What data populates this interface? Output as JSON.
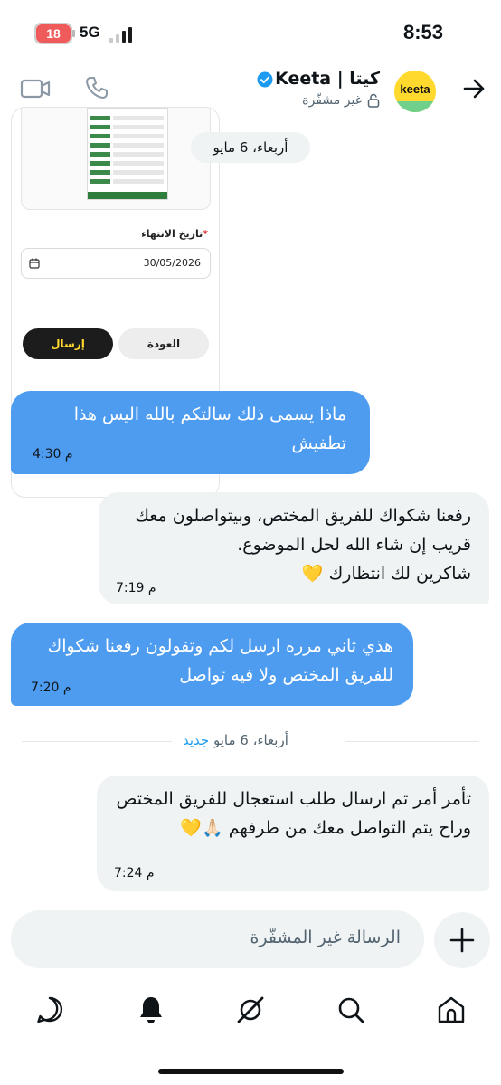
{
  "status_bar": {
    "battery": "18",
    "network": "5G",
    "time": "8:53"
  },
  "header": {
    "name": "Keeta | كيتا",
    "subtitle": "غير مشفّرة",
    "avatar_text": "keeta",
    "colors": {
      "avatar_bg": "#ffd92e",
      "verified": "#1d9bf0"
    }
  },
  "form_card": {
    "end_date_label": "تاريخ الانتهاء",
    "required_mark": "*",
    "end_date_value": "30/05/2026",
    "send_label": "إرسال",
    "back_label": "العودة"
  },
  "date_pill": "أربعاء، 6 مايو",
  "messages": [
    {
      "direction": "out",
      "text": "ماذا يسمى ذلك سالتكم بالله اليس هذا تطفيش",
      "time": "4:30 م"
    },
    {
      "direction": "in",
      "text": "رفعنا شكواك للفريق المختص، وبيتواصلون معك قريب إن شاء الله لحل الموضوع.\nشاكرين لك انتظارك 💛",
      "time": "7:19 م"
    },
    {
      "direction": "out",
      "text": "هذي ثاني مرره ارسل لكم وتقولون رفعنا شكواك للفريق المختص ولا فيه تواصل",
      "time": "7:20 م"
    },
    {
      "direction": "in",
      "text": "تأمر أمر تم ارسال طلب استعجال للفريق المختص وراح يتم التواصل معك من طرفهم 🙏🏻💛",
      "time": "7:24 م"
    }
  ],
  "divider": {
    "date": "أربعاء، 6 مايو",
    "new_label": "جديد"
  },
  "composer": {
    "placeholder": "الرسالة غير المشفّرة"
  },
  "nav": {
    "items": [
      "home-icon",
      "search-icon",
      "grok-icon",
      "notifications-icon",
      "messages-icon"
    ]
  },
  "colors": {
    "outgoing_bubble": "#4d9cf0",
    "incoming_bubble": "#eff3f4",
    "accent": "#1d9bf0"
  }
}
